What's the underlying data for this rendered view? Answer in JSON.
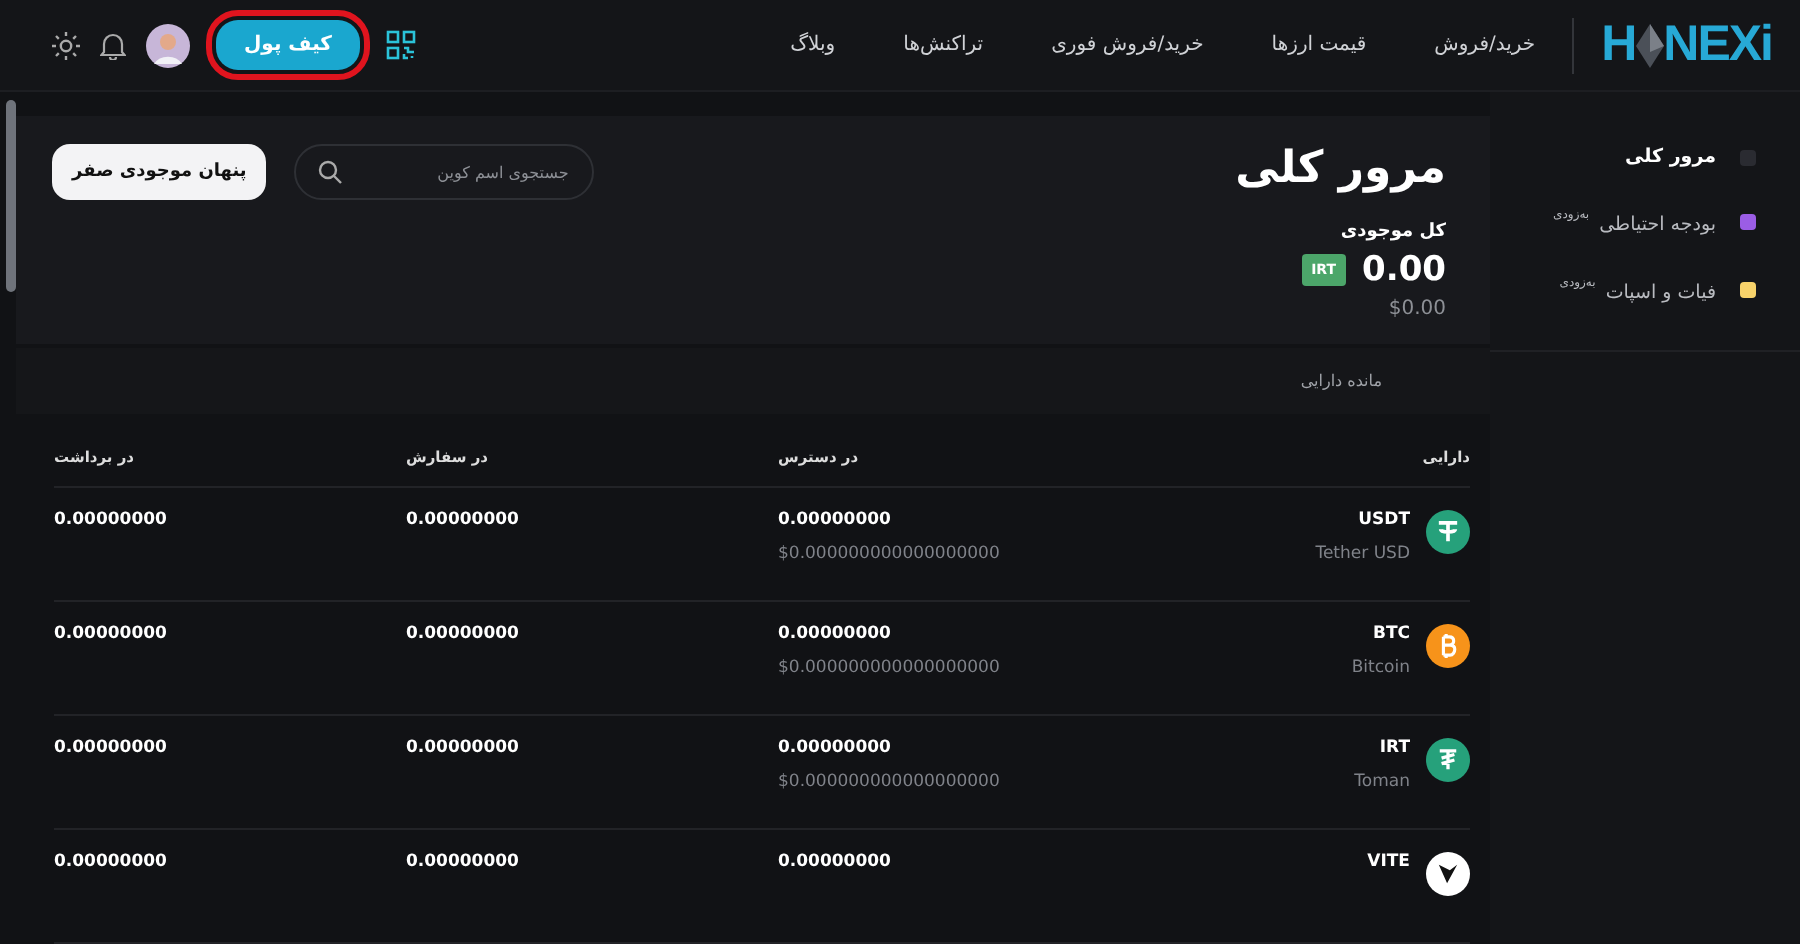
{
  "header": {
    "logo": {
      "left": "H",
      "right": "NEXi"
    },
    "nav": [
      {
        "label": "خرید/فروش"
      },
      {
        "label": "قیمت ارزها"
      },
      {
        "label": "خرید/فروش فوری"
      },
      {
        "label": "تراکنش‌ها"
      },
      {
        "label": "وبلاگ"
      }
    ],
    "wallet_button": {
      "label": "کیف پول",
      "highlighted": true
    }
  },
  "sidebar": {
    "items": [
      {
        "label": "مرور کلی",
        "selected": true,
        "color": "#2a2b31"
      },
      {
        "label": "بودجه احتیاطی$^{به‌زودی}$",
        "selected": false,
        "color": "#9b5de5"
      },
      {
        "label": "فیات و اسپات$^{به‌زودی}$",
        "selected": false,
        "color": "#f7d26a"
      }
    ]
  },
  "overview": {
    "title": "مرور کلی",
    "search": {
      "placeholder": "جستجوی اسم کوین"
    },
    "hide_zero_button": "پنهان موجودی صفر",
    "balance_label": "کل موجودی",
    "balance": "0.00",
    "currency": "IRT",
    "balance_usd": "$0.00"
  },
  "assets": {
    "title": "مانده دارایی",
    "columns": [
      "دارایی",
      "در دسترس",
      "در سفارش",
      "در برداشت"
    ],
    "rows": [
      {
        "symbol": "USDT",
        "name": "Tether USD",
        "kind": "tether",
        "color": "#26a17b",
        "available": "0.00000000",
        "available_usd": "$0.000000000000000000",
        "in_order": "0.00000000",
        "in_withdrawal": "0.00000000"
      },
      {
        "symbol": "BTC",
        "name": "Bitcoin",
        "kind": "bitcoin",
        "color": "#f7931a",
        "available": "0.00000000",
        "available_usd": "$0.000000000000000000",
        "in_order": "0.00000000",
        "in_withdrawal": "0.00000000"
      },
      {
        "symbol": "IRT",
        "name": "Toman",
        "kind": "toman",
        "color": "#26a17b",
        "available": "0.00000000",
        "available_usd": "$0.000000000000000000",
        "in_order": "0.00000000",
        "in_withdrawal": "0.00000000"
      },
      {
        "symbol": "VITE",
        "kind": "vite",
        "color": "#ffffff",
        "available": "0.00000000",
        "in_order": "0.00000000",
        "in_withdrawal": "0.00000000"
      }
    ]
  }
}
